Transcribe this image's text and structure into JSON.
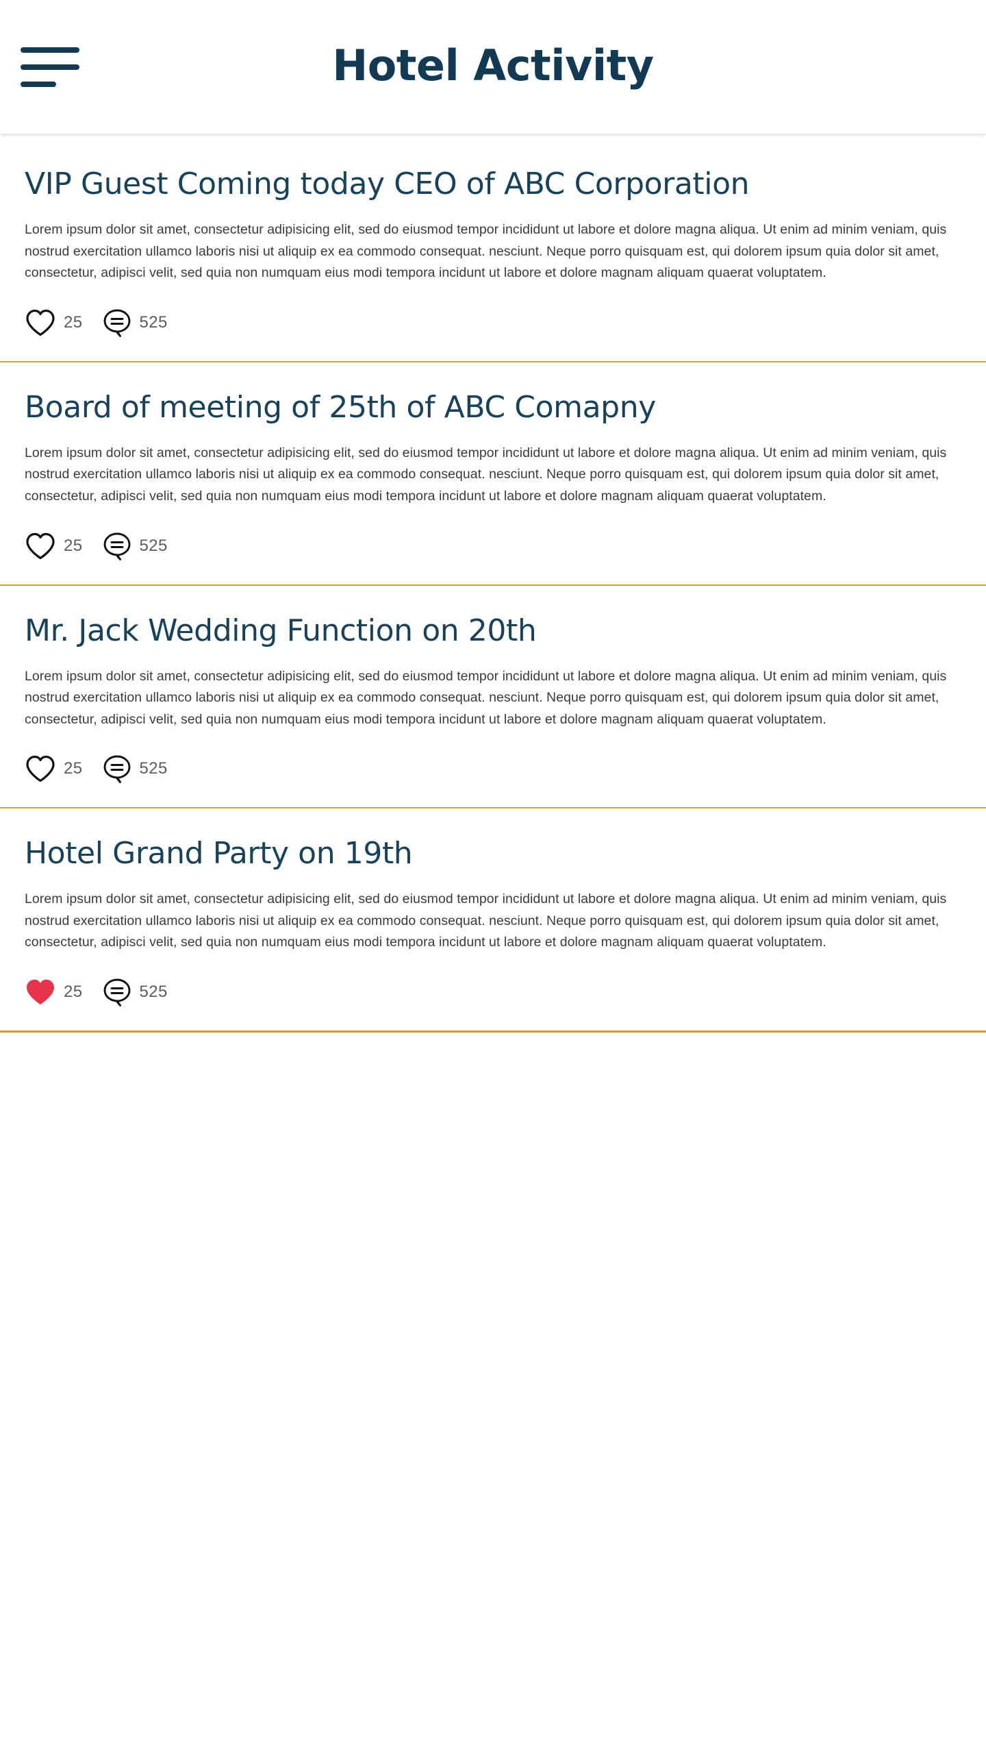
{
  "header": {
    "title": "Hotel Activity",
    "menu_icon": "hamburger-menu-icon",
    "title_color": "#123a55"
  },
  "theme": {
    "accent_navy": "#17425c",
    "divider_gold": "#cfa63a",
    "divider_gold_strong": "#d99a25",
    "heart_filled_red": "#e8344a",
    "body_text": "#3b3b3b",
    "background": "#ffffff"
  },
  "feed": {
    "cards": [
      {
        "title": "VIP Guest Coming today CEO of ABC Corporation",
        "body": "Lorem ipsum dolor sit amet, consectetur adipisicing elit, sed do eiusmod tempor incididunt ut labore et dolore magna aliqua. Ut enim ad minim veniam, quis nostrud exercitation ullamco laboris nisi ut aliquip ex ea commodo consequat. nesciunt. Neque porro quisquam est, qui dolorem ipsum quia dolor sit amet, consectetur, adipisci velit, sed quia non numquam eius modi tempora incidunt ut labore et dolore magnam aliquam quaerat voluptatem.",
        "like": {
          "icon": "heart-outline-icon",
          "liked": false,
          "count": "25"
        },
        "comment": {
          "icon": "comment-bubble-icon",
          "count": "525"
        }
      },
      {
        "title": "Board of meeting of 25th of ABC Comapny",
        "body": "Lorem ipsum dolor sit amet, consectetur adipisicing elit, sed do eiusmod tempor incididunt ut labore et dolore magna aliqua. Ut enim ad minim veniam, quis nostrud exercitation ullamco laboris nisi ut aliquip ex ea commodo consequat. nesciunt. Neque porro quisquam est, qui dolorem ipsum quia dolor sit amet, consectetur, adipisci velit, sed quia non numquam eius modi tempora incidunt ut labore et dolore magnam aliquam quaerat voluptatem.",
        "like": {
          "icon": "heart-outline-icon",
          "liked": false,
          "count": "25"
        },
        "comment": {
          "icon": "comment-bubble-icon",
          "count": "525"
        }
      },
      {
        "title": "Mr. Jack Wedding Function on 20th",
        "body": "Lorem ipsum dolor sit amet, consectetur adipisicing elit, sed do eiusmod tempor incididunt ut labore et dolore magna aliqua. Ut enim ad minim veniam, quis nostrud exercitation ullamco laboris nisi ut aliquip ex ea commodo consequat. nesciunt. Neque porro quisquam est, qui dolorem ipsum quia dolor sit amet, consectetur, adipisci velit, sed quia non numquam eius modi tempora incidunt ut labore et dolore magnam aliquam quaerat voluptatem.",
        "like": {
          "icon": "heart-outline-icon",
          "liked": false,
          "count": "25"
        },
        "comment": {
          "icon": "comment-bubble-icon",
          "count": "525"
        }
      },
      {
        "title": "Hotel Grand Party on 19th",
        "body": "Lorem ipsum dolor sit amet, consectetur adipisicing elit, sed do eiusmod tempor incididunt ut labore et dolore magna aliqua. Ut enim ad minim veniam, quis nostrud exercitation ullamco laboris nisi ut aliquip ex ea commodo consequat. nesciunt. Neque porro quisquam est, qui dolorem ipsum quia dolor sit amet, consectetur, adipisci velit, sed quia non numquam eius modi tempora incidunt ut labore et dolore magnam aliquam quaerat voluptatem.",
        "like": {
          "icon": "heart-filled-icon",
          "liked": true,
          "count": "25"
        },
        "comment": {
          "icon": "comment-bubble-icon",
          "count": "525"
        }
      }
    ]
  }
}
